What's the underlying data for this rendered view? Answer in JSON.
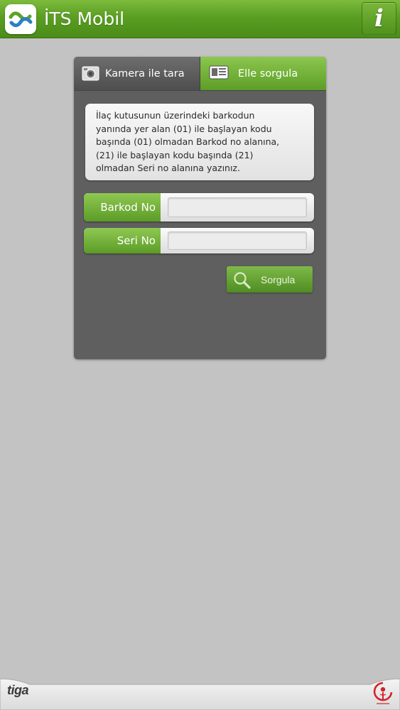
{
  "app_bar": {
    "title": "İTS Mobil",
    "logo_icon": "its-logo-icon",
    "info_button": {
      "glyph": "i",
      "icon": "info-icon"
    }
  },
  "tabs": [
    {
      "label": "Kamera ile tara",
      "icon": "camera-icon",
      "active": false
    },
    {
      "label": "Elle sorgula",
      "icon": "document-icon",
      "active": true
    }
  ],
  "instructions": {
    "lines": [
      "İlaç kutusunun üzerindeki barkodun",
      "yanında yer alan (01) ile başlayan kodu",
      "başında (01) olmadan Barkod no alanına,",
      "(21) ile başlayan kodu başında (21)",
      "olmadan Seri no alanına yazınız."
    ]
  },
  "form": {
    "barkod": {
      "label": "Barkod No",
      "value": "",
      "placeholder": ""
    },
    "seri": {
      "label": "Seri No",
      "value": "",
      "placeholder": ""
    },
    "search_button": {
      "label": "Sorgula",
      "icon": "search-icon"
    }
  },
  "footer": {
    "brand_left": "tiga",
    "brand_right_icon": "ministry-emblem-icon"
  },
  "colors": {
    "accent_green": "#5a9e23",
    "panel_gray": "#5f5f5f",
    "background": "#c3c3c3"
  }
}
